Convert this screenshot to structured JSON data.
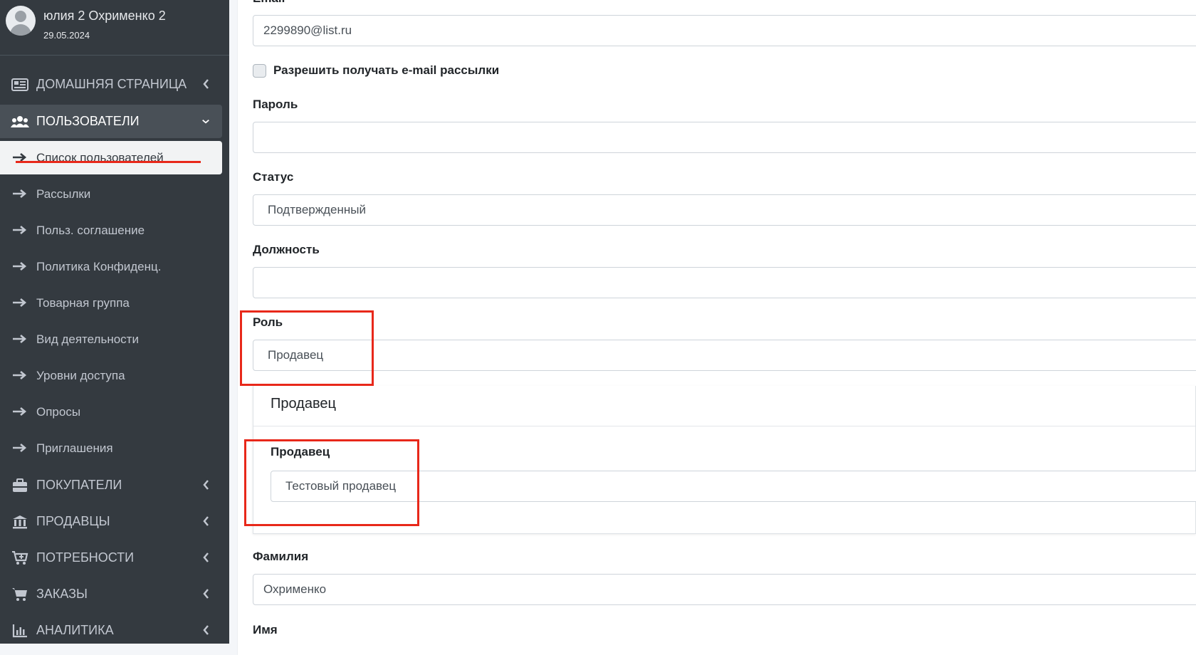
{
  "user": {
    "name": "юлия 2 Охрименко 2",
    "date": "29.05.2024"
  },
  "nav": {
    "home": "ДОМАШНЯЯ СТРАНИЦА",
    "users": "ПОЛЬЗОВАТЕЛИ",
    "sub": [
      "Список пользователей",
      "Рассылки",
      "Польз. соглашение",
      "Политика Конфиденц.",
      "Товарная группа",
      "Вид деятельности",
      "Уровни доступа",
      "Опросы",
      "Приглашения"
    ],
    "buyers": "ПОКУПАТЕЛИ",
    "sellers": "ПРОДАВЦЫ",
    "needs": "ПОТРЕБНОСТИ",
    "orders": "ЗАКАЗЫ",
    "analytics": "АНАЛИТИКА"
  },
  "form": {
    "email_label": "Email",
    "email_value": "2299890@list.ru",
    "newsletter_label": "Разрешить получать e-mail рассылки",
    "password_label": "Пароль",
    "password_value": "",
    "status_label": "Статус",
    "status_value": "Подтвержденный",
    "position_label": "Должность",
    "position_value": "",
    "role_label": "Роль",
    "role_value": "Продавец",
    "role_option": "Продавец",
    "seller_label": "Продавец",
    "seller_value": "Тестовый продавец",
    "lastname_label": "Фамилия",
    "lastname_value": "Охрименко",
    "firstname_label": "Имя"
  },
  "colors": {
    "sidebar": "#343a40",
    "accent_red": "#e8281a",
    "active_item": "#f2f3f4"
  }
}
